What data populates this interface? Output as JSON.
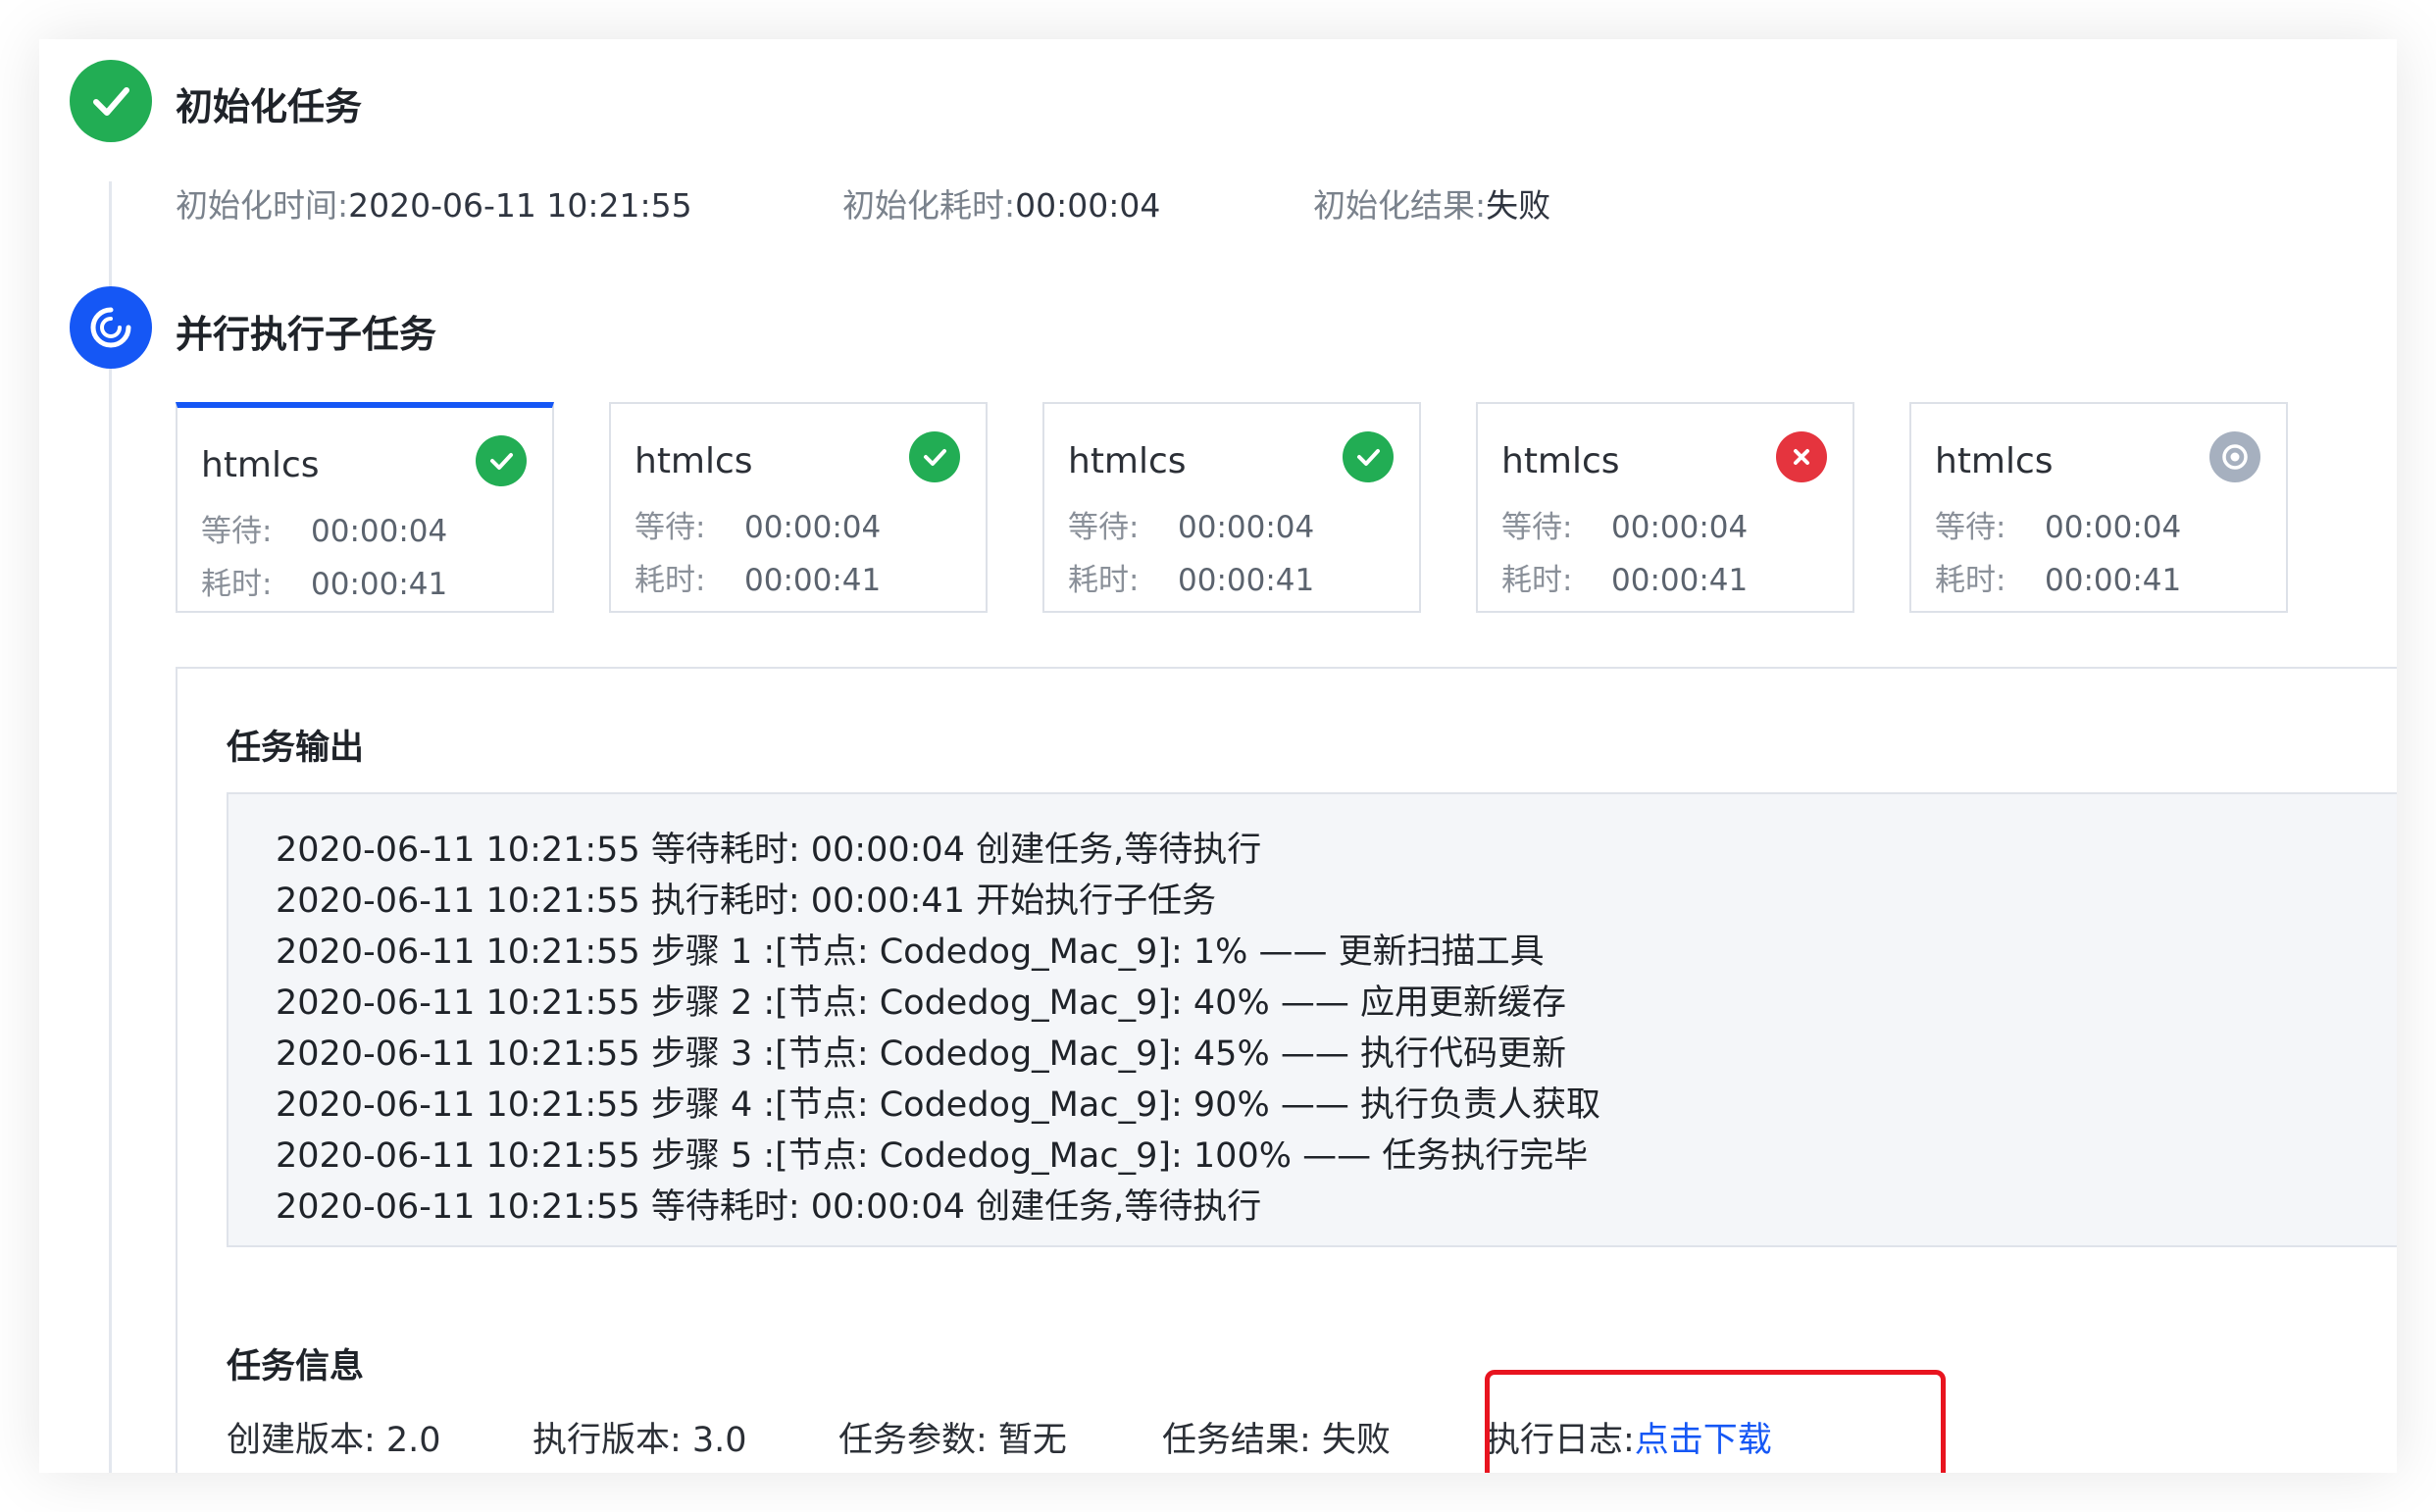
{
  "init_step": {
    "title": "初始化任务",
    "status_icon": "check-icon",
    "time_label": "初始化时间:",
    "time_value": "2020-06-11 10:21:55",
    "duration_label": "初始化耗时:",
    "duration_value": "00:00:04",
    "result_label": "初始化结果:",
    "result_value": "失败"
  },
  "parallel_step": {
    "title": "并行执行子任务",
    "status_icon": "loading-spinner-icon"
  },
  "subtasks": [
    {
      "name": "htmlcs",
      "status": "success",
      "wait_label": "等待:",
      "wait_value": "00:00:04",
      "cost_label": "耗时:",
      "cost_value": "00:00:41"
    },
    {
      "name": "htmlcs",
      "status": "success",
      "wait_label": "等待:",
      "wait_value": "00:00:04",
      "cost_label": "耗时:",
      "cost_value": "00:00:41"
    },
    {
      "name": "htmlcs",
      "status": "success",
      "wait_label": "等待:",
      "wait_value": "00:00:04",
      "cost_label": "耗时:",
      "cost_value": "00:00:41"
    },
    {
      "name": "htmlcs",
      "status": "failed",
      "wait_label": "等待:",
      "wait_value": "00:00:04",
      "cost_label": "耗时:",
      "cost_value": "00:00:41"
    },
    {
      "name": "htmlcs",
      "status": "pending",
      "wait_label": "等待:",
      "wait_value": "00:00:04",
      "cost_label": "耗时:",
      "cost_value": "00:00:41"
    }
  ],
  "output": {
    "title": "任务输出",
    "lines": [
      "2020-06-11 10:21:55  等待耗时: 00:00:04 创建任务,等待执行",
      "2020-06-11 10:21:55  执行耗时: 00:00:41 开始执行子任务",
      "2020-06-11 10:21:55  步骤 1 :[节点: Codedog_Mac_9]: 1% —— 更新扫描工具",
      "2020-06-11 10:21:55  步骤 2 :[节点: Codedog_Mac_9]: 40% —— 应用更新缓存",
      "2020-06-11 10:21:55  步骤 3 :[节点: Codedog_Mac_9]: 45% —— 执行代码更新",
      "2020-06-11 10:21:55  步骤 4 :[节点: Codedog_Mac_9]: 90% —— 执行负责人获取",
      "2020-06-11 10:21:55  步骤 5 :[节点: Codedog_Mac_9]: 100% —— 任务执行完毕",
      "2020-06-11 10:21:55  等待耗时: 00:00:04 创建任务,等待执行"
    ]
  },
  "info": {
    "title": "任务信息",
    "create_version": "创建版本: 2.0",
    "exec_version": "执行版本: 3.0",
    "params": "任务参数: 暂无",
    "result": "任务结果: 失败",
    "log_label": "执行日志:",
    "log_link": "点击下载"
  },
  "colors": {
    "success": "#22ad54",
    "running": "#1557f5",
    "failed": "#e5343e",
    "pending": "#a6b0bf",
    "link": "#1557f5",
    "highlight": "#e8141f"
  }
}
